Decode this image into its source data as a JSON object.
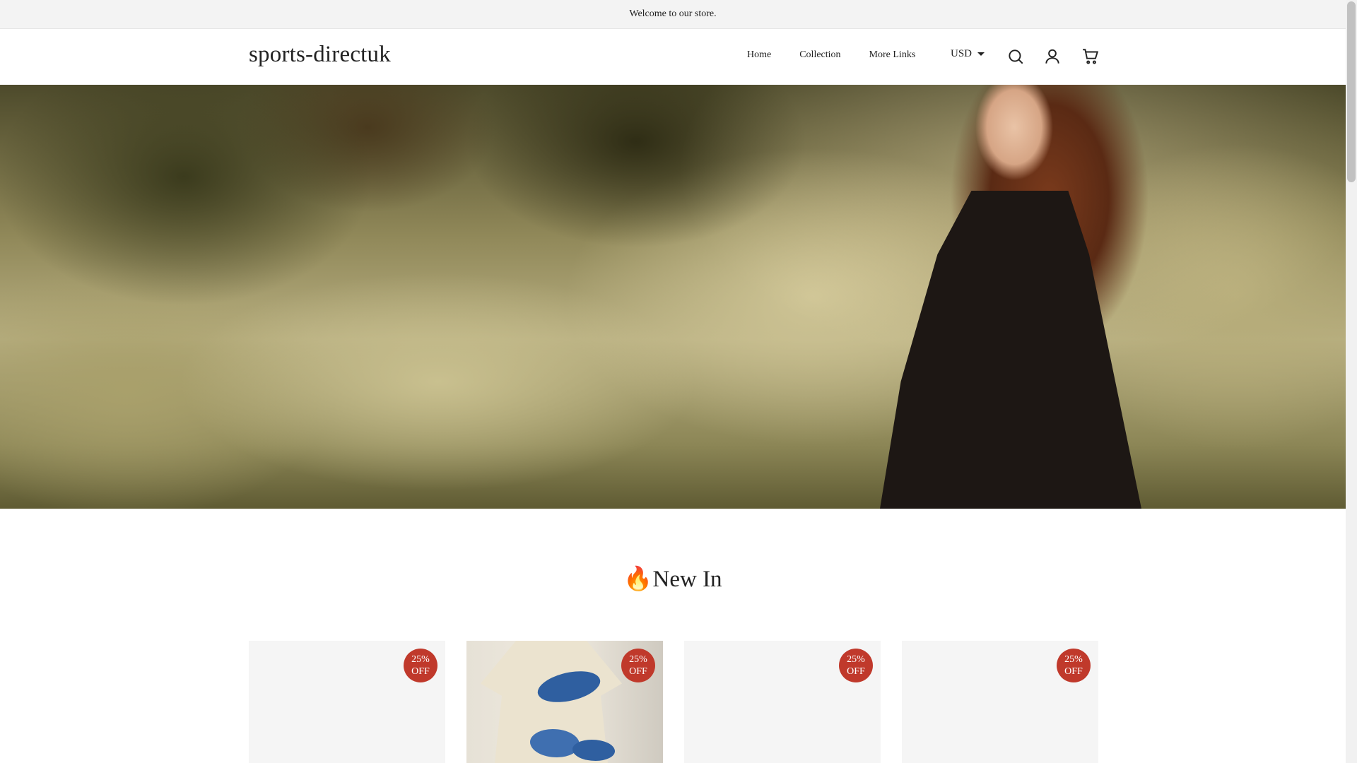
{
  "announcement": {
    "text": "Welcome to our store."
  },
  "header": {
    "logo": "sports-directuk",
    "nav": [
      {
        "label": "Home"
      },
      {
        "label": "Collection"
      },
      {
        "label": "More Links"
      }
    ],
    "currency": "USD",
    "icons": [
      "search-icon",
      "account-icon",
      "cart-icon"
    ]
  },
  "hero": {
    "image": "woman in black lace dress in golden meadow"
  },
  "section": {
    "title": "🔥New In"
  },
  "products": [
    {
      "badge_line1": "25%",
      "badge_line2": "OFF",
      "image": "placeholder"
    },
    {
      "badge_line1": "25%",
      "badge_line2": "OFF",
      "image": "blue fish print linen dress"
    },
    {
      "badge_line1": "25%",
      "badge_line2": "OFF",
      "image": "placeholder"
    },
    {
      "badge_line1": "25%",
      "badge_line2": "OFF",
      "image": "placeholder"
    }
  ],
  "colors": {
    "announcement_bg": "#f3f3f3",
    "badge": "#c0392b",
    "text": "#222222"
  }
}
